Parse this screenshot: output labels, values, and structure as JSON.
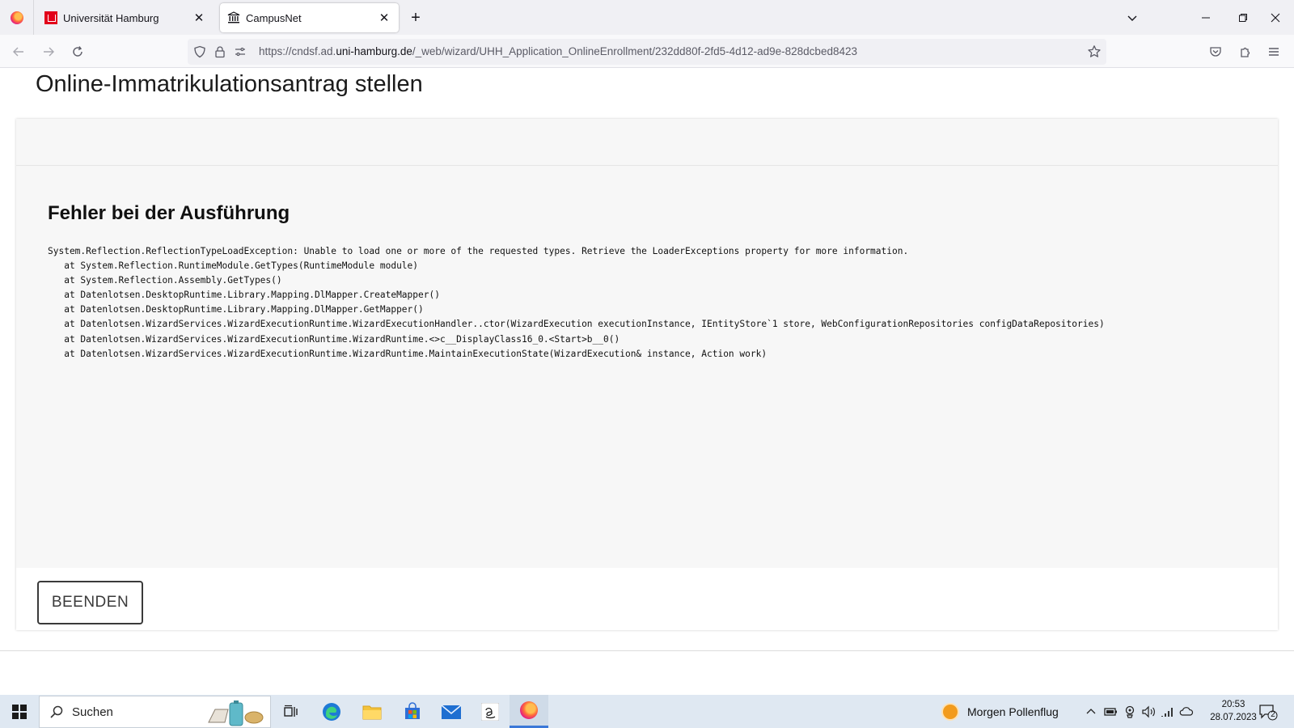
{
  "browser": {
    "tabs": [
      {
        "title": "Universität Hamburg",
        "icon": "uhh-logo-icon",
        "active": false
      },
      {
        "title": "CampusNet",
        "icon": "bank-icon",
        "active": true
      }
    ],
    "url_prefix": "https://cndsf.ad.",
    "url_domain": "uni-hamburg.de",
    "url_path": "/_web/wizard/UHH_Application_OnlineEnrollment/232dd80f-2fd5-4d12-ad9e-828dcbed8423"
  },
  "page": {
    "title": "Online-Immatrikulationsantrag stellen",
    "error_title": "Fehler bei der Ausführung",
    "error_lines": [
      "System.Reflection.ReflectionTypeLoadException: Unable to load one or more of the requested types. Retrieve the LoaderExceptions property for more information.",
      "   at System.Reflection.RuntimeModule.GetTypes(RuntimeModule module)",
      "   at System.Reflection.Assembly.GetTypes()",
      "   at Datenlotsen.DesktopRuntime.Library.Mapping.DlMapper.CreateMapper()",
      "   at Datenlotsen.DesktopRuntime.Library.Mapping.DlMapper.GetMapper()",
      "   at Datenlotsen.WizardServices.WizardExecutionRuntime.WizardExecutionHandler..ctor(WizardExecution executionInstance, IEntityStore`1 store, WebConfigurationRepositories configDataRepositories)",
      "   at Datenlotsen.WizardServices.WizardExecutionRuntime.WizardRuntime.<>c__DisplayClass16_0.<Start>b__0()",
      "   at Datenlotsen.WizardServices.WizardExecutionRuntime.WizardRuntime.MaintainExecutionState(WizardExecution& instance, Action work)"
    ],
    "finish_button": "BEENDEN"
  },
  "taskbar": {
    "search_label": "Suchen",
    "weather_text": "Morgen Pollenflug",
    "time": "20:53",
    "date": "28.07.2023",
    "notification_count": "2",
    "colors": {
      "accent": "#3b78d8",
      "taskbar_bg": "#dfe8f2"
    }
  }
}
